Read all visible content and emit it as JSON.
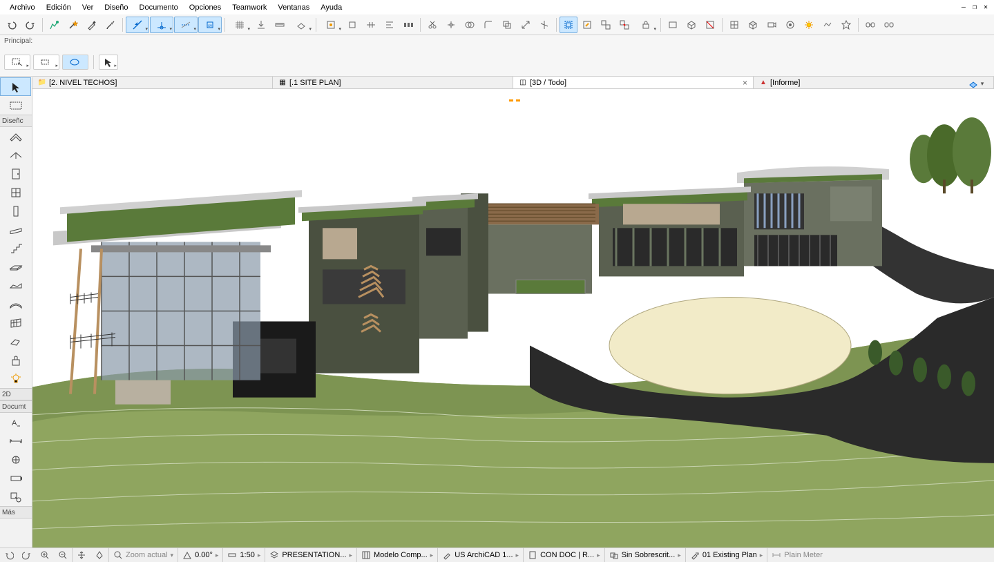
{
  "menu": {
    "items": [
      "Archivo",
      "Edición",
      "Ver",
      "Diseño",
      "Documento",
      "Opciones",
      "Teamwork",
      "Ventanas",
      "Ayuda"
    ]
  },
  "principal": {
    "label": "Principal:"
  },
  "tabs": [
    {
      "icon": "folder",
      "label": "[2. NIVEL TECHOS]",
      "active": false
    },
    {
      "icon": "plan",
      "label": "[.1 SITE PLAN]",
      "active": false
    },
    {
      "icon": "cube",
      "label": "[3D / Todo]",
      "active": true,
      "closable": true
    },
    {
      "icon": "report",
      "label": "[Informe]",
      "active": false
    }
  ],
  "left_sections": {
    "design": "Diseñc",
    "two_d": "2D",
    "document": "Documt",
    "more": "Más"
  },
  "status": {
    "zoom_label": "Zoom actual",
    "angle": "0.00°",
    "scale": "1:50",
    "items": [
      "PRESENTATION...",
      "Modelo Comp...",
      "US ArchiCAD 1...",
      "CON DOC | R...",
      "Sin Sobrescrit...",
      "01 Existing Plan",
      "Plain Meter"
    ]
  }
}
